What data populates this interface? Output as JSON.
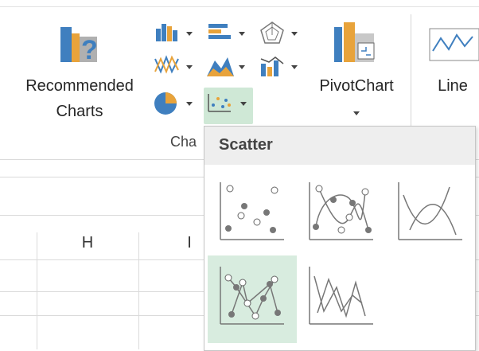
{
  "ribbon": {
    "recommended_charts": {
      "line1": "Recommended",
      "line2": "Charts"
    },
    "charts_group_label": "Cha",
    "pivotchart_label": "PivotChart",
    "line_label": "Line"
  },
  "sheet": {
    "columns": [
      "H",
      "I"
    ]
  },
  "gallery": {
    "title": "Scatter",
    "items": [
      {
        "icon": "scatter-markers-icon"
      },
      {
        "icon": "scatter-smooth-lines-markers-icon"
      },
      {
        "icon": "scatter-smooth-lines-icon"
      },
      {
        "icon": "scatter-straight-lines-markers-icon",
        "selected": true
      },
      {
        "icon": "scatter-straight-lines-icon"
      }
    ]
  },
  "colors": {
    "accent_blue": "#3f7fbf",
    "accent_orange": "#e8a33b",
    "selected_bg": "#d8ecdf"
  }
}
